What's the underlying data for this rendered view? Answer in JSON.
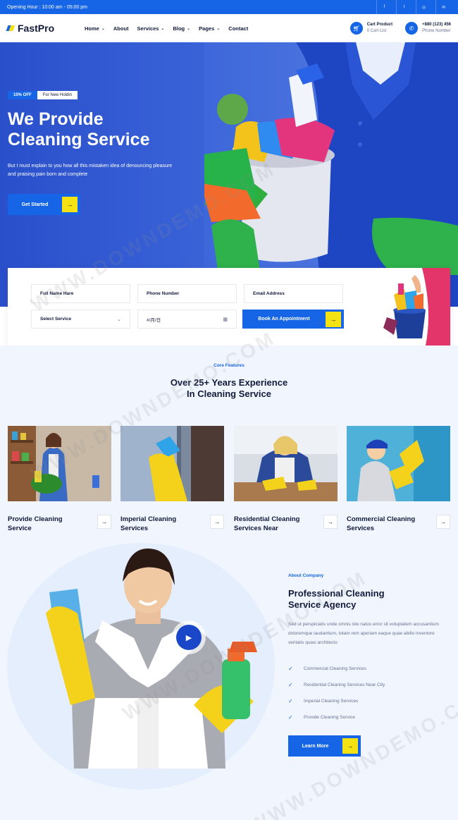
{
  "topbar": {
    "hours": "Opening Hour : 10:00 am - 05:00 pm",
    "socials": [
      "facebook-icon",
      "twitter-icon",
      "instagram-icon",
      "email-icon"
    ],
    "social_glyphs": [
      "f",
      "t",
      "◎",
      "✉"
    ]
  },
  "header": {
    "logo": "FastPro",
    "nav": [
      {
        "label": "Home",
        "dropdown": true
      },
      {
        "label": "About",
        "dropdown": false
      },
      {
        "label": "Services",
        "dropdown": true
      },
      {
        "label": "Blog",
        "dropdown": true
      },
      {
        "label": "Pages",
        "dropdown": true
      },
      {
        "label": "Contact",
        "dropdown": false
      }
    ],
    "cart_title": "Cart Product",
    "cart_sub": "0 Cart List",
    "phone_title": "+880 (123) 456",
    "phone_sub": "Phone Number"
  },
  "hero": {
    "badge_off": "10% OFF",
    "badge_text": "For New Holdin",
    "title_line1": "We Provide",
    "title_line2": "Cleaning Service",
    "description": "But I must explain to you how all this mistaken idea of denouncing pleasure and praising pain born and complete",
    "cta": "Get Started"
  },
  "booking": {
    "full_name": "Full Name Hare",
    "phone": "Phone Number",
    "email": "Email Address",
    "select_service": "Select Service",
    "date": "#/月/日",
    "book_btn": "Book An Appointment"
  },
  "features": {
    "tag": "Core Features",
    "title_line1": "Over 25+ Years Experience",
    "title_line2": "In Cleaning Service",
    "cards": [
      {
        "title": "Provide Cleaning Service"
      },
      {
        "title": "Imperial Cleaning Services"
      },
      {
        "title": "Residential Cleaning Services Near"
      },
      {
        "title": "Commercial Cleaning Services"
      }
    ]
  },
  "about": {
    "tag": "About Company",
    "title_line1": "Professional Cleaning",
    "title_line2": "Service Agency",
    "description": "Sed ut perspiciatis unde omnis iste natus error sit voluptatem accusantium doloremque laudantium, totam rem aperiam eaque quae abillo inventore veritatis quasi architecto",
    "list": [
      "Commercial Cleaning Services",
      "Residential Cleaning Services Near City",
      "Imperial Cleaning Services",
      "Provide Cleaning Service"
    ],
    "cta": "Learn More"
  },
  "watermark": "WWW.DOWNDEMO.COM",
  "colors": {
    "primary": "#1565e6",
    "accent": "#f4e212",
    "dark": "#111a3a"
  }
}
